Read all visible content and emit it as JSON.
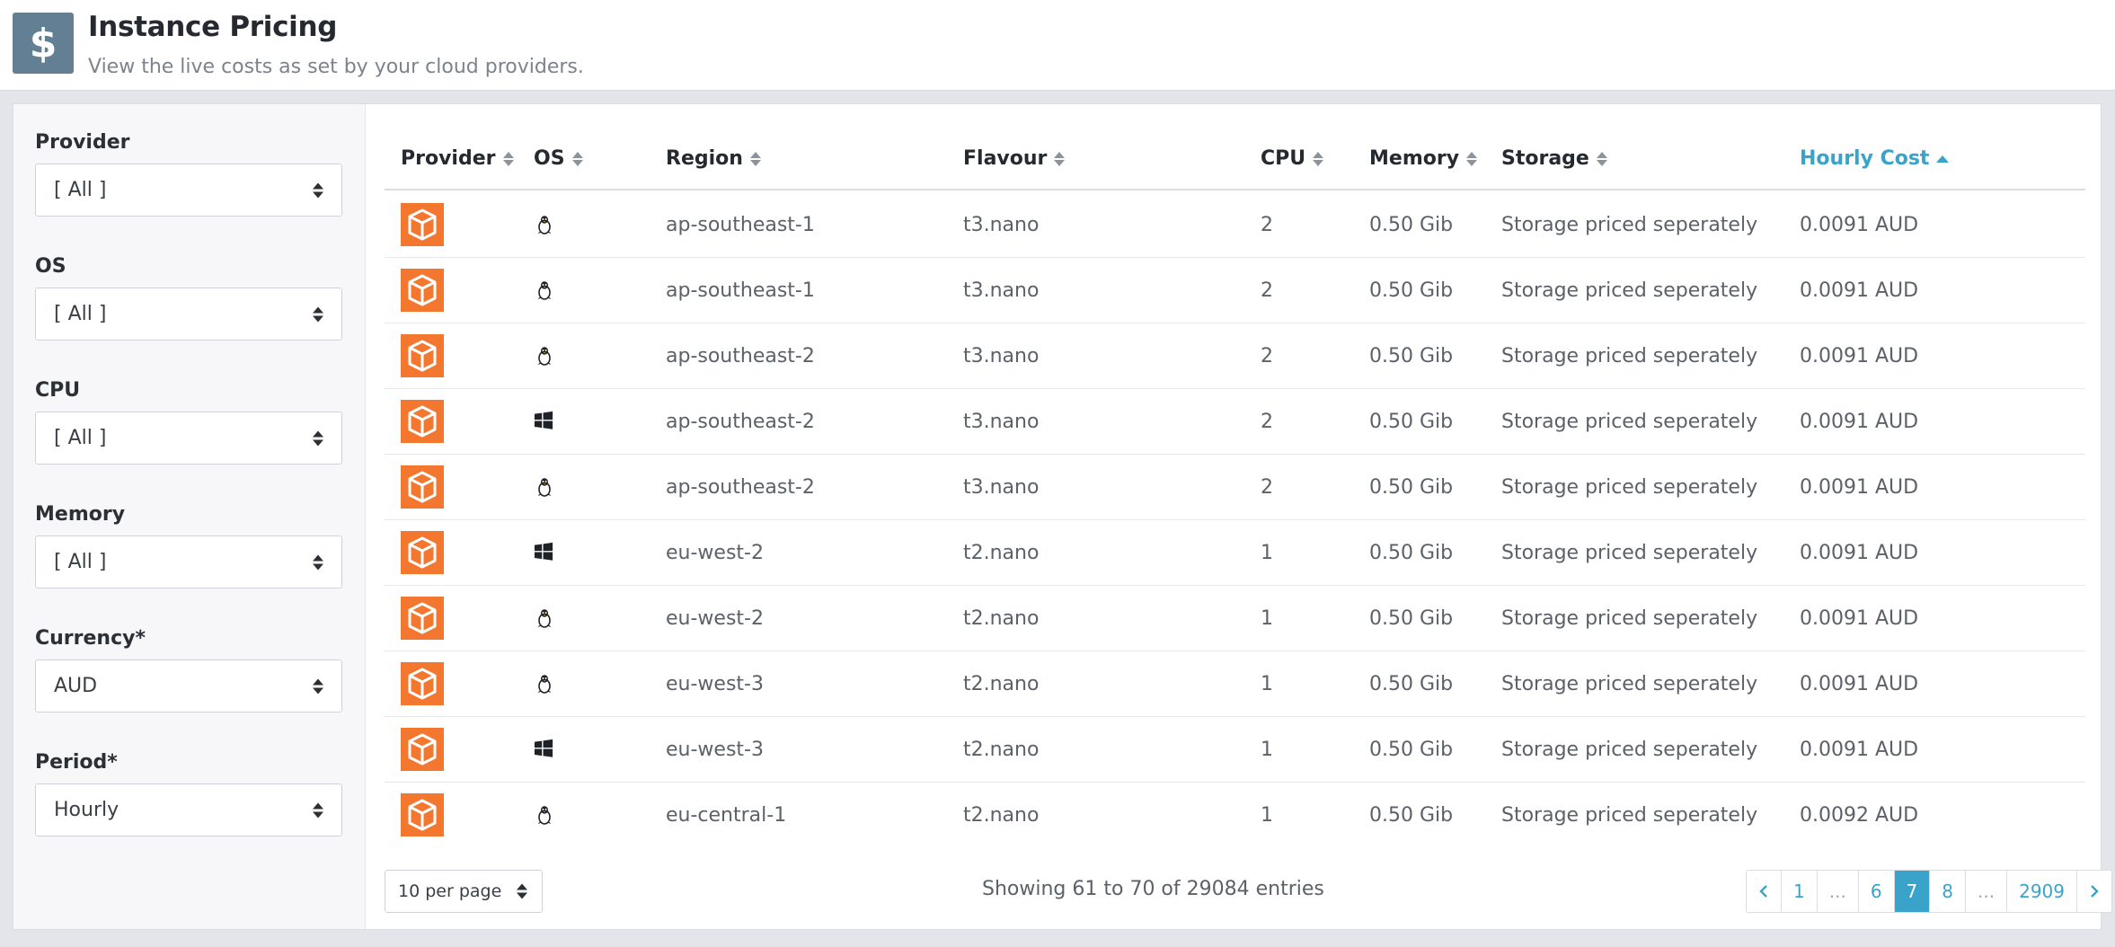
{
  "header": {
    "icon_glyph": "$",
    "title": "Instance Pricing",
    "subtitle": "View the live costs as set by your cloud providers."
  },
  "filters": [
    {
      "label": "Provider",
      "value": "[ All ]"
    },
    {
      "label": "OS",
      "value": "[ All ]"
    },
    {
      "label": "CPU",
      "value": "[ All ]"
    },
    {
      "label": "Memory",
      "value": "[ All ]"
    },
    {
      "label": "Currency*",
      "value": "AUD"
    },
    {
      "label": "Period*",
      "value": "Hourly"
    }
  ],
  "table": {
    "columns": [
      "Provider",
      "OS",
      "Region",
      "Flavour",
      "CPU",
      "Memory",
      "Storage",
      "Hourly Cost"
    ],
    "sorted_column": "Hourly Cost",
    "sort_direction": "ascending",
    "rows": [
      {
        "provider": "aws",
        "os": "linux",
        "region": "ap-southeast-1",
        "flavour": "t3.nano",
        "cpu": "2",
        "memory": "0.50 Gib",
        "storage": "Storage priced seperately",
        "cost": "0.0091 AUD"
      },
      {
        "provider": "aws",
        "os": "linux",
        "region": "ap-southeast-1",
        "flavour": "t3.nano",
        "cpu": "2",
        "memory": "0.50 Gib",
        "storage": "Storage priced seperately",
        "cost": "0.0091 AUD"
      },
      {
        "provider": "aws",
        "os": "linux",
        "region": "ap-southeast-2",
        "flavour": "t3.nano",
        "cpu": "2",
        "memory": "0.50 Gib",
        "storage": "Storage priced seperately",
        "cost": "0.0091 AUD"
      },
      {
        "provider": "aws",
        "os": "windows",
        "region": "ap-southeast-2",
        "flavour": "t3.nano",
        "cpu": "2",
        "memory": "0.50 Gib",
        "storage": "Storage priced seperately",
        "cost": "0.0091 AUD"
      },
      {
        "provider": "aws",
        "os": "linux",
        "region": "ap-southeast-2",
        "flavour": "t3.nano",
        "cpu": "2",
        "memory": "0.50 Gib",
        "storage": "Storage priced seperately",
        "cost": "0.0091 AUD"
      },
      {
        "provider": "aws",
        "os": "windows",
        "region": "eu-west-2",
        "flavour": "t2.nano",
        "cpu": "1",
        "memory": "0.50 Gib",
        "storage": "Storage priced seperately",
        "cost": "0.0091 AUD"
      },
      {
        "provider": "aws",
        "os": "linux",
        "region": "eu-west-2",
        "flavour": "t2.nano",
        "cpu": "1",
        "memory": "0.50 Gib",
        "storage": "Storage priced seperately",
        "cost": "0.0091 AUD"
      },
      {
        "provider": "aws",
        "os": "linux",
        "region": "eu-west-3",
        "flavour": "t2.nano",
        "cpu": "1",
        "memory": "0.50 Gib",
        "storage": "Storage priced seperately",
        "cost": "0.0091 AUD"
      },
      {
        "provider": "aws",
        "os": "windows",
        "region": "eu-west-3",
        "flavour": "t2.nano",
        "cpu": "1",
        "memory": "0.50 Gib",
        "storage": "Storage priced seperately",
        "cost": "0.0091 AUD"
      },
      {
        "provider": "aws",
        "os": "linux",
        "region": "eu-central-1",
        "flavour": "t2.nano",
        "cpu": "1",
        "memory": "0.50 Gib",
        "storage": "Storage priced seperately",
        "cost": "0.0092 AUD"
      }
    ]
  },
  "footer": {
    "per_page": "10 per page",
    "entries_info": "Showing 61 to 70 of 29084 entries",
    "pages": [
      "1",
      "...",
      "6",
      "7",
      "8",
      "...",
      "2909"
    ],
    "current_page": "7"
  },
  "colors": {
    "header_icon_bg": "#627f94",
    "provider_logo": "#f4772f",
    "accent": "#3aa3c9"
  }
}
